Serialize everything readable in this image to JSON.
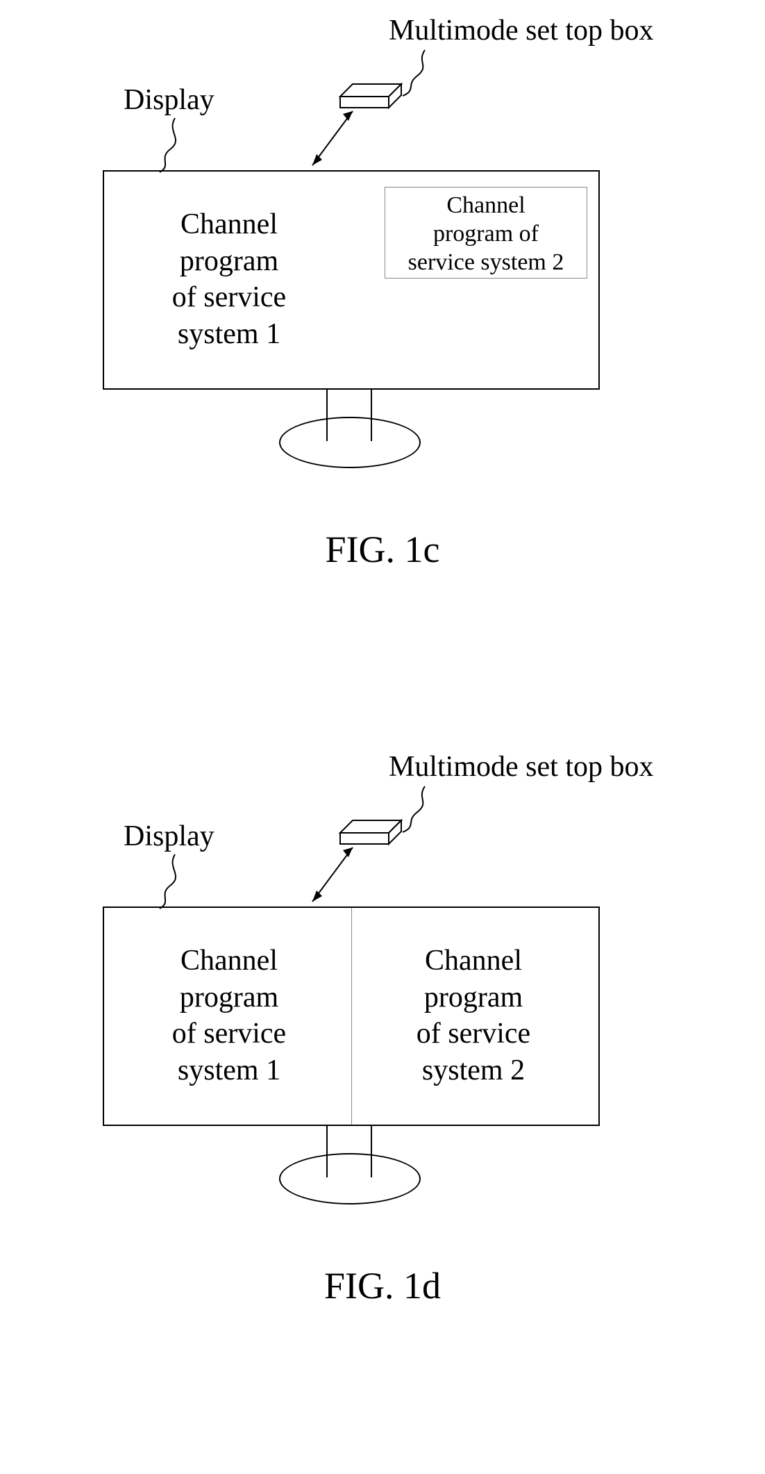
{
  "fig_c": {
    "stb_label": "Multimode set top box",
    "display_label": "Display",
    "main_text": "Channel\nprogram\nof service\nsystem 1",
    "pip_text": "Channel\nprogram of\nservice system 2",
    "caption": "FIG. 1c"
  },
  "fig_d": {
    "stb_label": "Multimode set top box",
    "display_label": "Display",
    "left_text": "Channel\nprogram\nof service\nsystem 1",
    "right_text": "Channel\nprogram\nof service\nsystem 2",
    "caption": "FIG. 1d"
  }
}
